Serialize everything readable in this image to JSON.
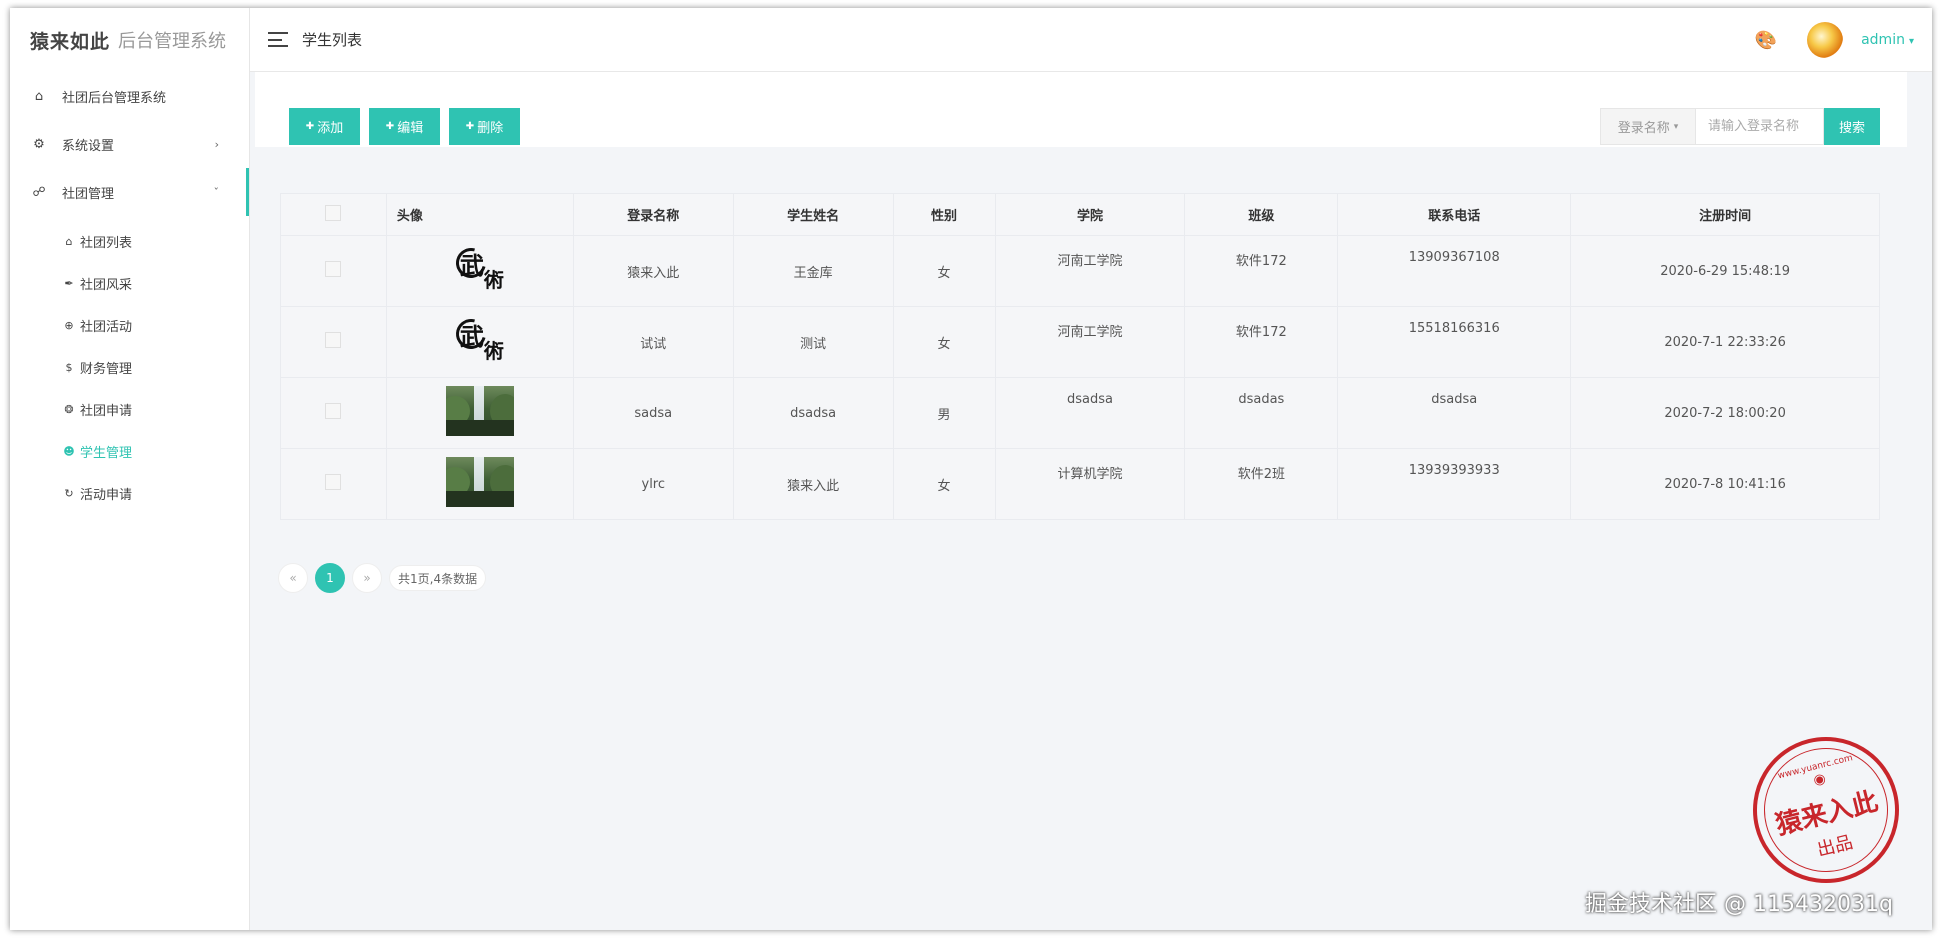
{
  "logo": {
    "brand": "猿来如此",
    "subtitle": "后台管理系统"
  },
  "sidebar": {
    "items": [
      {
        "label": "社团后台管理系统",
        "icon": "home-icon"
      },
      {
        "label": "系统设置",
        "icon": "gear-icon"
      },
      {
        "label": "社团管理",
        "icon": "group-icon"
      }
    ],
    "subitems": [
      {
        "label": "社团列表",
        "icon": "home-icon"
      },
      {
        "label": "社团风采",
        "icon": "feather-icon"
      },
      {
        "label": "社团活动",
        "icon": "plus-circle-icon"
      },
      {
        "label": "财务管理",
        "icon": "dollar-icon"
      },
      {
        "label": "社团申请",
        "icon": "support-icon"
      },
      {
        "label": "学生管理",
        "icon": "user-circle-icon",
        "active": true
      },
      {
        "label": "活动申请",
        "icon": "history-icon"
      }
    ]
  },
  "header": {
    "title": "学生列表",
    "username": "admin"
  },
  "toolbar": {
    "add": "添加",
    "edit": "编辑",
    "delete": "删除",
    "search_field": "登录名称",
    "search_placeholder": "请输入登录名称",
    "search_button": "搜索"
  },
  "table": {
    "columns": [
      "头像",
      "登录名称",
      "学生姓名",
      "性别",
      "学院",
      "班级",
      "联系电话",
      "注册时间"
    ],
    "rows": [
      {
        "avatar": "calligraphy",
        "login": "猿来入此",
        "name": "王金库",
        "gender": "女",
        "college": "河南工学院",
        "class": "软件172",
        "phone": "13909367108",
        "registered": "2020-6-29 15:48:19"
      },
      {
        "avatar": "calligraphy",
        "login": "试试",
        "name": "测试",
        "gender": "女",
        "college": "河南工学院",
        "class": "软件172",
        "phone": "15518166316",
        "registered": "2020-7-1 22:33:26"
      },
      {
        "avatar": "landscape",
        "login": "sadsa",
        "name": "dsadsa",
        "gender": "男",
        "college": "dsadsa",
        "class": "dsadas",
        "phone": "dsadsa",
        "registered": "2020-7-2 18:00:20"
      },
      {
        "avatar": "landscape",
        "login": "ylrc",
        "name": "猿来入此",
        "gender": "女",
        "college": "计算机学院",
        "class": "软件2班",
        "phone": "13939393933",
        "registered": "2020-7-8 10:41:16"
      }
    ]
  },
  "pager": {
    "prev": "«",
    "current": "1",
    "next": "»",
    "info": "共1页,4条数据"
  },
  "stamp": {
    "url": "www.yuanrc.com",
    "main": "猿来入此",
    "sub": "出品"
  },
  "watermark": "掘金技术社区 @ 115432031q"
}
